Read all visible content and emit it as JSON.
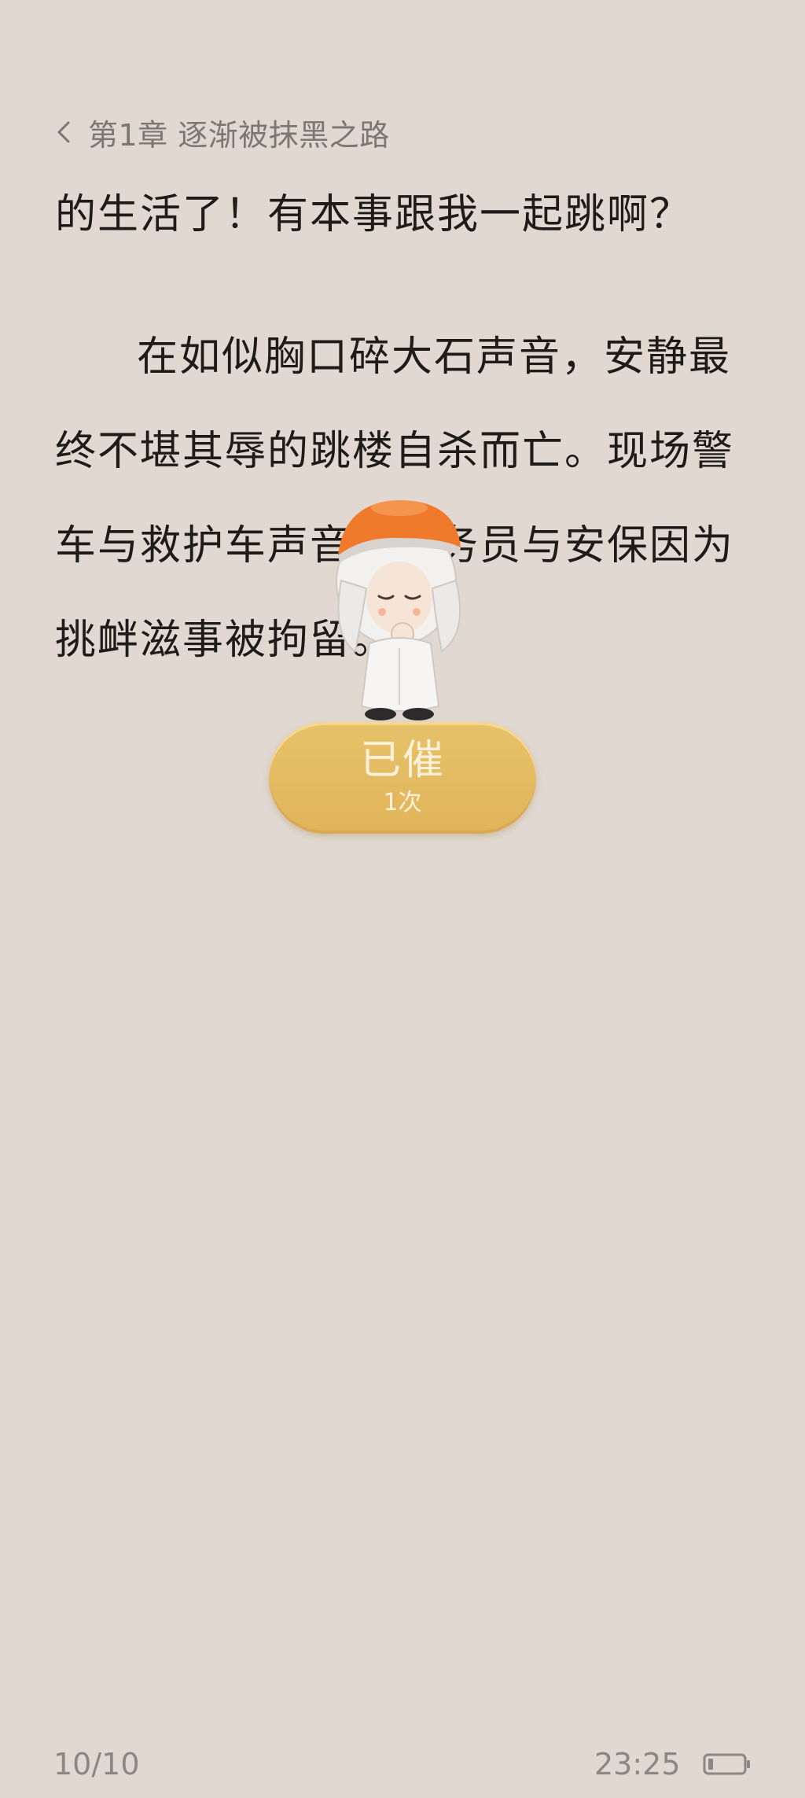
{
  "header": {
    "back_icon": "chevron-left-icon",
    "chapter_title": "第1章 逐渐被抹黑之路"
  },
  "content": {
    "paragraphs": [
      "的生活了！有本事跟我一起跳啊？",
      "在如似胸口碎大石声音，安静最终不堪其辱的跳楼自杀而亡。现场警车与救护车声音，服务员与安保因为挑衅滋事被拘留。"
    ]
  },
  "mascot": {
    "icon": "mascot-figure-icon"
  },
  "urge_button": {
    "label": "已催",
    "count": "1次"
  },
  "footer": {
    "page": "10/10",
    "time": "23:25",
    "battery_icon": "battery-icon"
  },
  "colors": {
    "background": "#e0d8d1",
    "button": "#e1b45a",
    "text": "#1e1b18",
    "muted": "#8d8681"
  }
}
